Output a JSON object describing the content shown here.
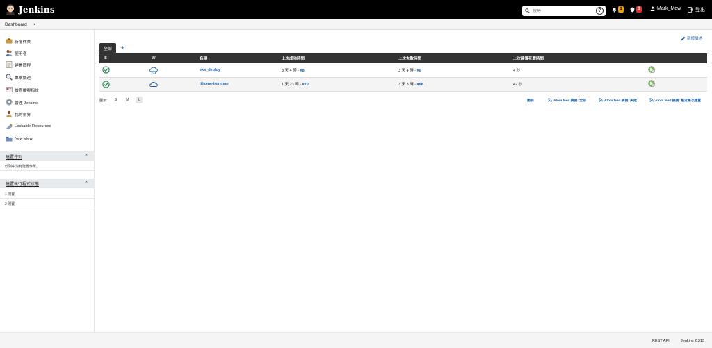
{
  "header": {
    "app_name": "Jenkins",
    "search_placeholder": "搜尋",
    "help": "?",
    "notifications_count": "1",
    "security_count": "1",
    "user_name": "Mark_Mew",
    "logout": "登出"
  },
  "breadcrumb": {
    "dashboard": "Dashboard"
  },
  "sidebar": {
    "items": [
      {
        "label": "新增作業",
        "icon": "new-item-icon"
      },
      {
        "label": "使用者",
        "icon": "people-icon"
      },
      {
        "label": "建置歷程",
        "icon": "build-history-icon"
      },
      {
        "label": "專案關連",
        "icon": "project-relationship-icon"
      },
      {
        "label": "檢查檔案指紋",
        "icon": "fingerprint-icon"
      },
      {
        "label": "管理 Jenkins",
        "icon": "gear-icon"
      },
      {
        "label": "我的視界",
        "icon": "my-views-icon"
      },
      {
        "label": "Lockable Resources",
        "icon": "lockable-resources-icon"
      },
      {
        "label": "New View",
        "icon": "folder-icon"
      }
    ],
    "build_queue": {
      "title": "建置佇列",
      "empty_text": "佇列中沒有建置作業。"
    },
    "executors": {
      "title": "建置執行程式狀態",
      "rows": [
        "1  閒置",
        "2  閒置"
      ]
    }
  },
  "main": {
    "add_description": "新增描述",
    "tabs": [
      {
        "label": "全部"
      }
    ],
    "add_tab": "+",
    "columns": {
      "s": "S",
      "w": "W",
      "name": "名稱 ↓",
      "last_success": "上次成功時間",
      "last_failure": "上次失敗時間",
      "last_duration": "上次建置花費時間"
    },
    "jobs": [
      {
        "name": "eks_deploy",
        "last_success": "3 天 4 時 - ",
        "last_success_build": "#8",
        "last_failure": "3 天 4 時 - ",
        "last_failure_build": "#6",
        "duration": "4 秒",
        "weather": "cloud-rain"
      },
      {
        "name": "ithome-ironman",
        "last_success": "1 天 23 時 - ",
        "last_success_build": "#70",
        "last_failure": "3 天 3 時 - ",
        "last_failure_build": "#68",
        "duration": "42 秒",
        "weather": "cloud"
      }
    ],
    "icon_size_label": "圖示:",
    "icon_sizes": [
      "S",
      "M",
      "L"
    ],
    "selected_icon_size": "L",
    "legend_link": "圖例",
    "feeds": {
      "all": "Atom feed 摘要: 全部",
      "failures": "Atom feed 摘要: 失敗",
      "latest": "Atom feed 摘要: 最近幾次建置"
    }
  },
  "footer": {
    "rest_api": "REST API",
    "version": "Jenkins 2.313"
  },
  "colors": {
    "header_bg": "#000000",
    "link": "#1a5fa8",
    "success": "#138347",
    "table_header": "#333333"
  }
}
